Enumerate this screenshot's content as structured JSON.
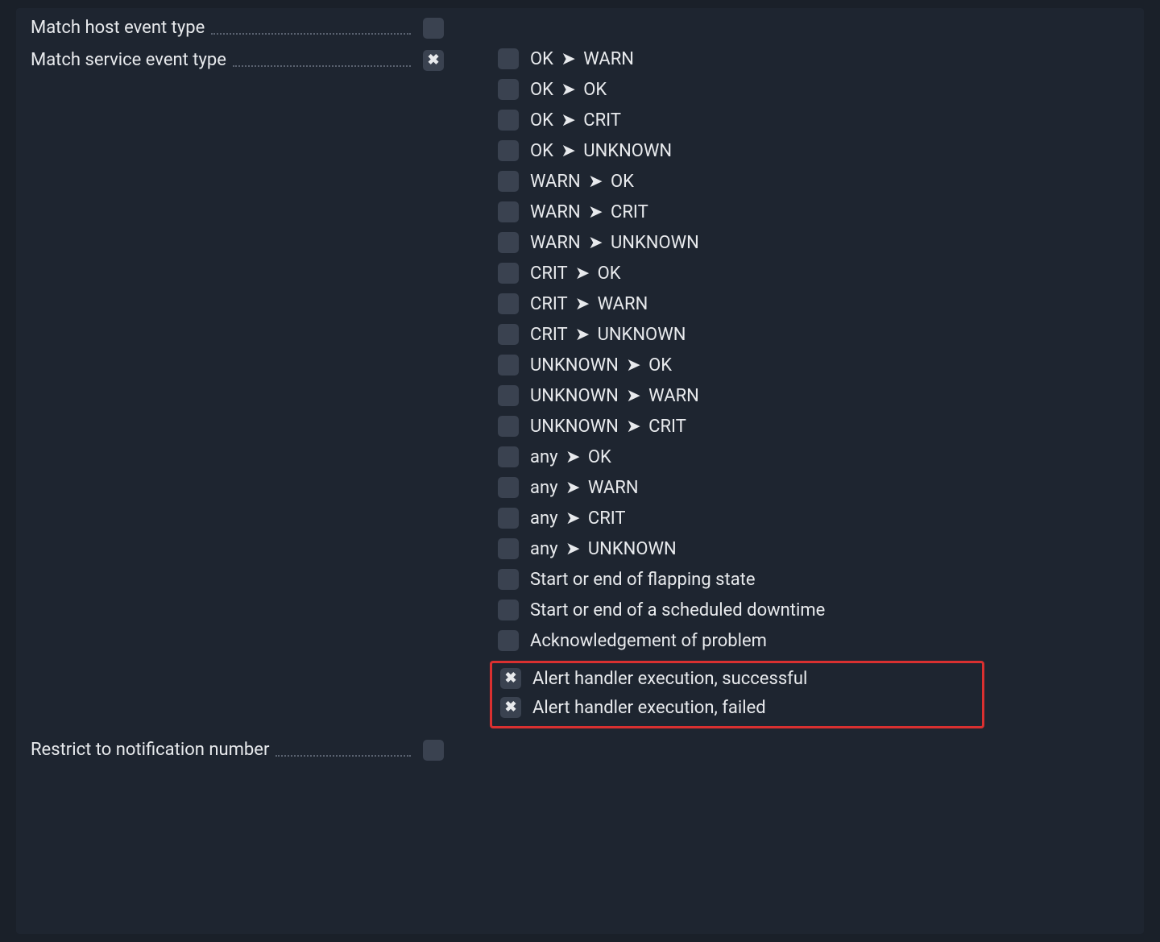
{
  "rows": {
    "match_host": {
      "label": "Match host event type"
    },
    "match_service": {
      "label": "Match service event type"
    },
    "restrict_notif": {
      "label": "Restrict to notification number"
    }
  },
  "service_options": [
    {
      "from": "OK",
      "to": "WARN",
      "checked": false
    },
    {
      "from": "OK",
      "to": "OK",
      "checked": false
    },
    {
      "from": "OK",
      "to": "CRIT",
      "checked": false
    },
    {
      "from": "OK",
      "to": "UNKNOWN",
      "checked": false
    },
    {
      "from": "WARN",
      "to": "OK",
      "checked": false
    },
    {
      "from": "WARN",
      "to": "CRIT",
      "checked": false
    },
    {
      "from": "WARN",
      "to": "UNKNOWN",
      "checked": false
    },
    {
      "from": "CRIT",
      "to": "OK",
      "checked": false
    },
    {
      "from": "CRIT",
      "to": "WARN",
      "checked": false
    },
    {
      "from": "CRIT",
      "to": "UNKNOWN",
      "checked": false
    },
    {
      "from": "UNKNOWN",
      "to": "OK",
      "checked": false
    },
    {
      "from": "UNKNOWN",
      "to": "WARN",
      "checked": false
    },
    {
      "from": "UNKNOWN",
      "to": "CRIT",
      "checked": false
    },
    {
      "from": "any",
      "to": "OK",
      "checked": false
    },
    {
      "from": "any",
      "to": "WARN",
      "checked": false
    },
    {
      "from": "any",
      "to": "CRIT",
      "checked": false
    },
    {
      "from": "any",
      "to": "UNKNOWN",
      "checked": false
    }
  ],
  "service_extra": [
    {
      "label": "Start or end of flapping state",
      "checked": false
    },
    {
      "label": "Start or end of a scheduled downtime",
      "checked": false
    },
    {
      "label": "Acknowledgement of problem",
      "checked": false
    }
  ],
  "service_highlight": [
    {
      "label": "Alert handler execution, successful",
      "checked": true
    },
    {
      "label": "Alert handler execution, failed",
      "checked": true
    }
  ],
  "arrow_glyph": "➤"
}
